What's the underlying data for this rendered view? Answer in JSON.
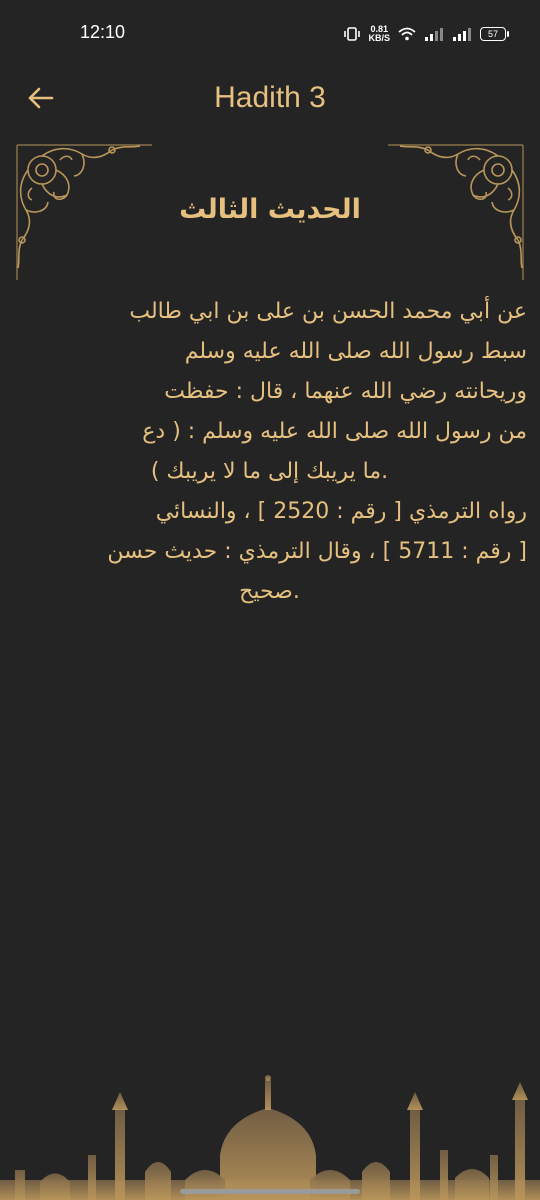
{
  "status_bar": {
    "time": "12:10",
    "net_speed_value": "0.81",
    "net_speed_unit": "KB/S",
    "battery": "57"
  },
  "app_bar": {
    "title": "Hadith 3"
  },
  "content": {
    "heading": "الحديث الثالث",
    "lines": [
      "عن أبي محمد الحسن بن على بن ابي طالب",
      "سبط رسول الله صلى الله عليه وسلم",
      "وريحانته رضي الله عنهما ، قال : حفظت",
      "من رسول الله صلى الله عليه وسلم : ( دع",
      ".ما يريبك إلى ما لا يريبك )",
      "رواه الترمذي [ رقم : 2520 ] ، والنسائي",
      "[ رقم : 5711 ] ، وقال الترمذي : حديث حسن",
      ".صحيح"
    ]
  },
  "colors": {
    "background": "#242424",
    "accent": "#e6c07f",
    "ornament": "#b8955a"
  },
  "icons": [
    "back-arrow-icon",
    "vibrate-icon",
    "wifi-icon",
    "signal-icon",
    "battery-icon"
  ]
}
